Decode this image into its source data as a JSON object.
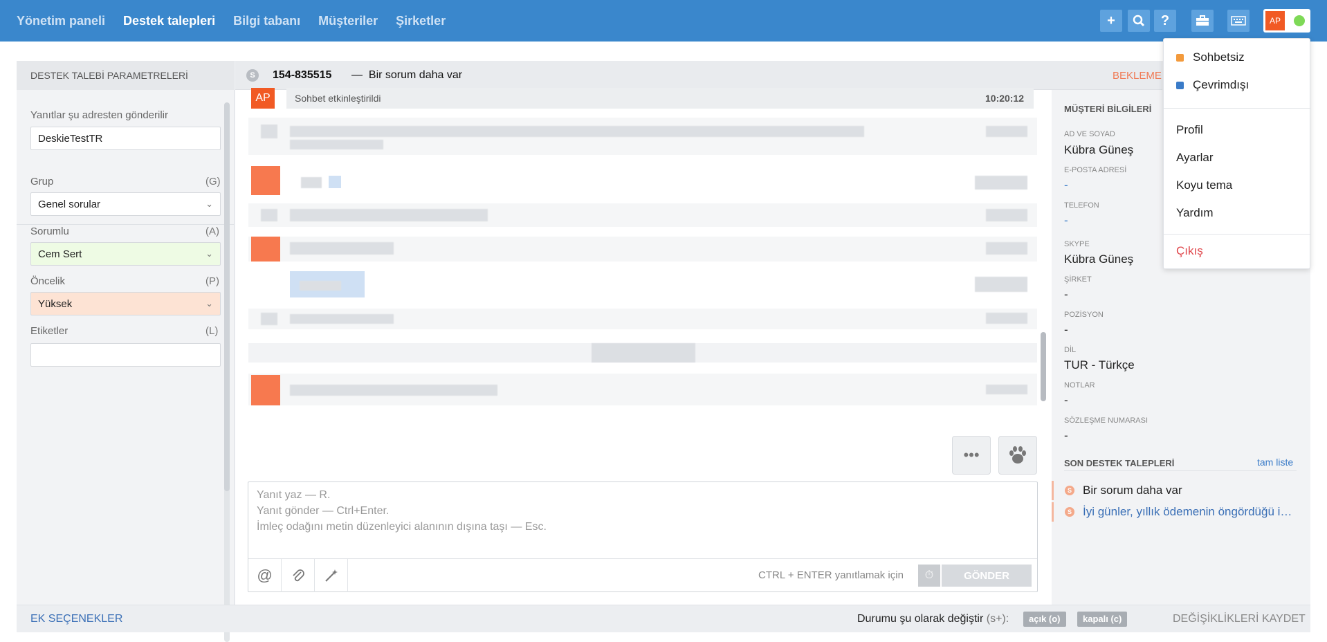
{
  "nav": {
    "items": [
      "Yönetim paneli",
      "Destek talepleri",
      "Bilgi tabanı",
      "Müşteriler",
      "Şirketler"
    ],
    "active": "Destek talepleri"
  },
  "toolbar": {
    "icons": [
      "plus-icon",
      "search-icon",
      "help-icon",
      "briefcase-icon",
      "keyboard-icon"
    ],
    "avatar_initials": "AP",
    "status_color": "#7ed957"
  },
  "left_panel": {
    "title": "DESTEK TALEBİ PARAMETRELERİ",
    "sender_label": "Yanıtlar şu adresten gönderilir",
    "sender_value": "DeskieTestTR",
    "group_label": "Grup",
    "group_key": "(G)",
    "group_value": "Genel sorular",
    "responsible_label": "Sorumlu",
    "responsible_key": "(A)",
    "responsible_value": "Cem Sert",
    "priority_label": "Öncelik",
    "priority_key": "(P)",
    "priority_value": "Yüksek",
    "tags_label": "Etiketler",
    "tags_key": "(L)",
    "tags_value": ""
  },
  "ticket": {
    "id": "154-835515",
    "separator": "—",
    "title": "Bir sorum daha var",
    "status": "BEKLEME"
  },
  "chat": {
    "system_avatar": "AP",
    "system_message": "Sohbet etkinleştirildi",
    "system_time": "10:20:12"
  },
  "reply": {
    "placeholder_lines": [
      "Yanıt yaz — R.",
      "Yanıt gönder — Ctrl+Enter.",
      "İmleç odağını metin düzenleyici alanının dışına taşı — Esc."
    ],
    "hint": "CTRL + ENTER yanıtlamak için",
    "send_label": "GÖNDER"
  },
  "customer": {
    "section_title": "MÜŞTERİ BİLGİLERİ",
    "fields": [
      {
        "label": "AD VE SOYAD",
        "value": "Kübra Güneş"
      },
      {
        "label": "E-POSTA ADRESİ",
        "value": "-"
      },
      {
        "label": "TELEFON",
        "value": "-"
      },
      {
        "label": "SKYPE",
        "value": "Kübra Güneş"
      },
      {
        "label": "ŞİRKET",
        "value": "-"
      },
      {
        "label": "POZİSYON",
        "value": "-"
      },
      {
        "label": "DİL",
        "value": "TUR - Türkçe"
      },
      {
        "label": "NOTLAR",
        "value": "-"
      },
      {
        "label": "SÖZLEŞME NUMARASI",
        "value": "-"
      }
    ],
    "recent_title": "SON DESTEK TALEPLERİ",
    "full_list": "tam liste",
    "recent": [
      "Bir sorum daha var",
      "İyi günler, yıllık ödemenin öngördüğü i…"
    ]
  },
  "footer": {
    "more_options": "EK SEÇENEKLER",
    "change_status": "Durumu şu olarak değiştir",
    "change_key": "(s+):",
    "open_badge": "açık (o)",
    "closed_badge": "kapalı (c)",
    "save": "DEĞİŞİKLİKLERİ KAYDET"
  },
  "dropdown": {
    "statuses": [
      {
        "label": "Sohbetsiz",
        "color": "#f39a3c"
      },
      {
        "label": "Çevrimdışı",
        "color": "#3a7bc8"
      }
    ],
    "menu": [
      "Profil",
      "Ayarlar",
      "Koyu tema",
      "Yardım"
    ],
    "logout": "Çıkış",
    "logout_color": "#e0474c"
  }
}
